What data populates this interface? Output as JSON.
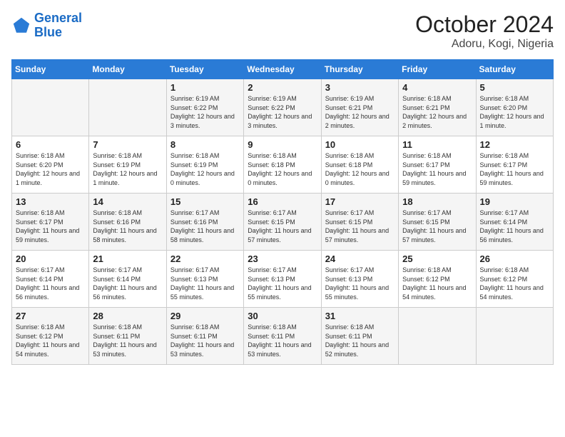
{
  "header": {
    "logo_line1": "General",
    "logo_line2": "Blue",
    "title": "October 2024",
    "subtitle": "Adoru, Kogi, Nigeria"
  },
  "days_of_week": [
    "Sunday",
    "Monday",
    "Tuesday",
    "Wednesday",
    "Thursday",
    "Friday",
    "Saturday"
  ],
  "weeks": [
    [
      {
        "day": "",
        "sunrise": "",
        "sunset": "",
        "daylight": ""
      },
      {
        "day": "",
        "sunrise": "",
        "sunset": "",
        "daylight": ""
      },
      {
        "day": "1",
        "sunrise": "Sunrise: 6:19 AM",
        "sunset": "Sunset: 6:22 PM",
        "daylight": "Daylight: 12 hours and 3 minutes."
      },
      {
        "day": "2",
        "sunrise": "Sunrise: 6:19 AM",
        "sunset": "Sunset: 6:22 PM",
        "daylight": "Daylight: 12 hours and 3 minutes."
      },
      {
        "day": "3",
        "sunrise": "Sunrise: 6:19 AM",
        "sunset": "Sunset: 6:21 PM",
        "daylight": "Daylight: 12 hours and 2 minutes."
      },
      {
        "day": "4",
        "sunrise": "Sunrise: 6:18 AM",
        "sunset": "Sunset: 6:21 PM",
        "daylight": "Daylight: 12 hours and 2 minutes."
      },
      {
        "day": "5",
        "sunrise": "Sunrise: 6:18 AM",
        "sunset": "Sunset: 6:20 PM",
        "daylight": "Daylight: 12 hours and 1 minute."
      }
    ],
    [
      {
        "day": "6",
        "sunrise": "Sunrise: 6:18 AM",
        "sunset": "Sunset: 6:20 PM",
        "daylight": "Daylight: 12 hours and 1 minute."
      },
      {
        "day": "7",
        "sunrise": "Sunrise: 6:18 AM",
        "sunset": "Sunset: 6:19 PM",
        "daylight": "Daylight: 12 hours and 1 minute."
      },
      {
        "day": "8",
        "sunrise": "Sunrise: 6:18 AM",
        "sunset": "Sunset: 6:19 PM",
        "daylight": "Daylight: 12 hours and 0 minutes."
      },
      {
        "day": "9",
        "sunrise": "Sunrise: 6:18 AM",
        "sunset": "Sunset: 6:18 PM",
        "daylight": "Daylight: 12 hours and 0 minutes."
      },
      {
        "day": "10",
        "sunrise": "Sunrise: 6:18 AM",
        "sunset": "Sunset: 6:18 PM",
        "daylight": "Daylight: 12 hours and 0 minutes."
      },
      {
        "day": "11",
        "sunrise": "Sunrise: 6:18 AM",
        "sunset": "Sunset: 6:17 PM",
        "daylight": "Daylight: 11 hours and 59 minutes."
      },
      {
        "day": "12",
        "sunrise": "Sunrise: 6:18 AM",
        "sunset": "Sunset: 6:17 PM",
        "daylight": "Daylight: 11 hours and 59 minutes."
      }
    ],
    [
      {
        "day": "13",
        "sunrise": "Sunrise: 6:18 AM",
        "sunset": "Sunset: 6:17 PM",
        "daylight": "Daylight: 11 hours and 59 minutes."
      },
      {
        "day": "14",
        "sunrise": "Sunrise: 6:18 AM",
        "sunset": "Sunset: 6:16 PM",
        "daylight": "Daylight: 11 hours and 58 minutes."
      },
      {
        "day": "15",
        "sunrise": "Sunrise: 6:17 AM",
        "sunset": "Sunset: 6:16 PM",
        "daylight": "Daylight: 11 hours and 58 minutes."
      },
      {
        "day": "16",
        "sunrise": "Sunrise: 6:17 AM",
        "sunset": "Sunset: 6:15 PM",
        "daylight": "Daylight: 11 hours and 57 minutes."
      },
      {
        "day": "17",
        "sunrise": "Sunrise: 6:17 AM",
        "sunset": "Sunset: 6:15 PM",
        "daylight": "Daylight: 11 hours and 57 minutes."
      },
      {
        "day": "18",
        "sunrise": "Sunrise: 6:17 AM",
        "sunset": "Sunset: 6:15 PM",
        "daylight": "Daylight: 11 hours and 57 minutes."
      },
      {
        "day": "19",
        "sunrise": "Sunrise: 6:17 AM",
        "sunset": "Sunset: 6:14 PM",
        "daylight": "Daylight: 11 hours and 56 minutes."
      }
    ],
    [
      {
        "day": "20",
        "sunrise": "Sunrise: 6:17 AM",
        "sunset": "Sunset: 6:14 PM",
        "daylight": "Daylight: 11 hours and 56 minutes."
      },
      {
        "day": "21",
        "sunrise": "Sunrise: 6:17 AM",
        "sunset": "Sunset: 6:14 PM",
        "daylight": "Daylight: 11 hours and 56 minutes."
      },
      {
        "day": "22",
        "sunrise": "Sunrise: 6:17 AM",
        "sunset": "Sunset: 6:13 PM",
        "daylight": "Daylight: 11 hours and 55 minutes."
      },
      {
        "day": "23",
        "sunrise": "Sunrise: 6:17 AM",
        "sunset": "Sunset: 6:13 PM",
        "daylight": "Daylight: 11 hours and 55 minutes."
      },
      {
        "day": "24",
        "sunrise": "Sunrise: 6:17 AM",
        "sunset": "Sunset: 6:13 PM",
        "daylight": "Daylight: 11 hours and 55 minutes."
      },
      {
        "day": "25",
        "sunrise": "Sunrise: 6:18 AM",
        "sunset": "Sunset: 6:12 PM",
        "daylight": "Daylight: 11 hours and 54 minutes."
      },
      {
        "day": "26",
        "sunrise": "Sunrise: 6:18 AM",
        "sunset": "Sunset: 6:12 PM",
        "daylight": "Daylight: 11 hours and 54 minutes."
      }
    ],
    [
      {
        "day": "27",
        "sunrise": "Sunrise: 6:18 AM",
        "sunset": "Sunset: 6:12 PM",
        "daylight": "Daylight: 11 hours and 54 minutes."
      },
      {
        "day": "28",
        "sunrise": "Sunrise: 6:18 AM",
        "sunset": "Sunset: 6:11 PM",
        "daylight": "Daylight: 11 hours and 53 minutes."
      },
      {
        "day": "29",
        "sunrise": "Sunrise: 6:18 AM",
        "sunset": "Sunset: 6:11 PM",
        "daylight": "Daylight: 11 hours and 53 minutes."
      },
      {
        "day": "30",
        "sunrise": "Sunrise: 6:18 AM",
        "sunset": "Sunset: 6:11 PM",
        "daylight": "Daylight: 11 hours and 53 minutes."
      },
      {
        "day": "31",
        "sunrise": "Sunrise: 6:18 AM",
        "sunset": "Sunset: 6:11 PM",
        "daylight": "Daylight: 11 hours and 52 minutes."
      },
      {
        "day": "",
        "sunrise": "",
        "sunset": "",
        "daylight": ""
      },
      {
        "day": "",
        "sunrise": "",
        "sunset": "",
        "daylight": ""
      }
    ]
  ]
}
